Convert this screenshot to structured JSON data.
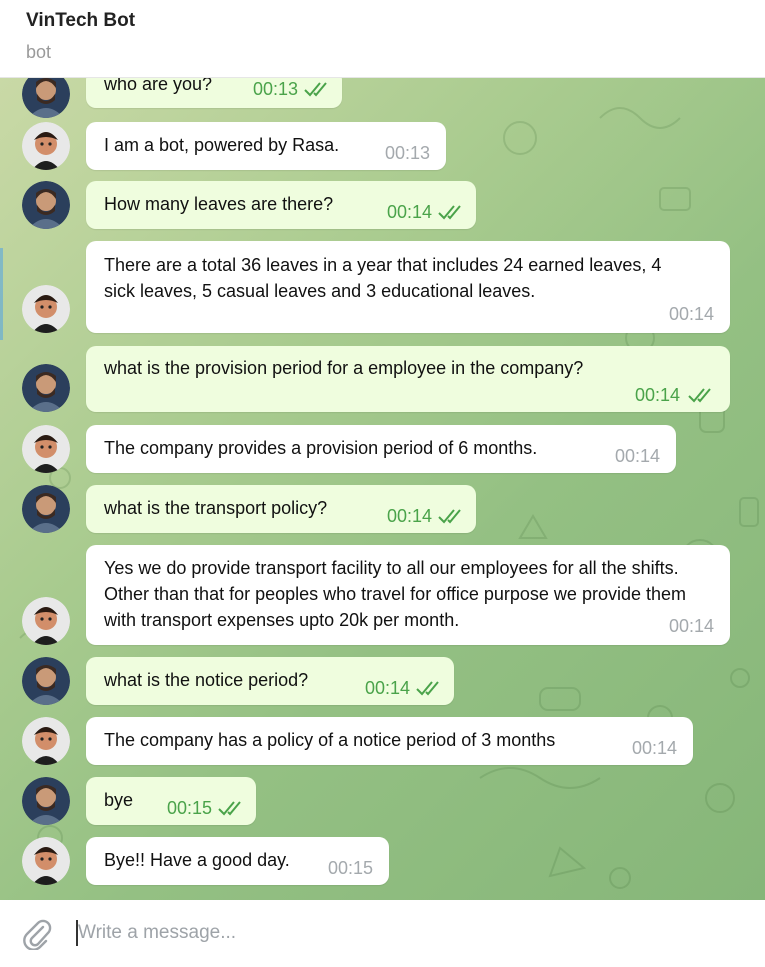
{
  "header": {
    "title": "VinTech Bot",
    "subtitle": "bot"
  },
  "messages": [
    {
      "from": "user",
      "text": "who are you?",
      "time": "00:13",
      "status": "read"
    },
    {
      "from": "bot",
      "text": "I am a bot, powered by Rasa.",
      "time": "00:13"
    },
    {
      "from": "user",
      "text": "How many leaves are there?",
      "time": "00:14",
      "status": "read"
    },
    {
      "from": "bot",
      "text": "There are a total 36 leaves in a year that includes 24 earned leaves, 4 sick leaves, 5 casual leaves and 3 educational leaves.",
      "time": "00:14"
    },
    {
      "from": "user",
      "text": "what is the provision period for a employee in the company?",
      "time": "00:14",
      "status": "read"
    },
    {
      "from": "bot",
      "text": "The company provides a provision period of 6 months.",
      "time": "00:14"
    },
    {
      "from": "user",
      "text": "what is the transport policy?",
      "time": "00:14",
      "status": "read"
    },
    {
      "from": "bot",
      "text": "Yes we do provide transport facility to all our employees for all the shifts. Other than that for peoples who travel for office purpose we provide them with transport expenses upto 20k per month.",
      "time": "00:14"
    },
    {
      "from": "user",
      "text": "what is the notice period?",
      "time": "00:14",
      "status": "read"
    },
    {
      "from": "bot",
      "text": "The company has a policy of a notice period of 3 months",
      "time": "00:14"
    },
    {
      "from": "user",
      "text": "bye",
      "time": "00:15",
      "status": "read"
    },
    {
      "from": "bot",
      "text": "Bye!! Have a good day.",
      "time": "00:15"
    }
  ],
  "composer": {
    "placeholder": "Write a message...",
    "attach_icon": "paperclip-icon"
  },
  "colors": {
    "outgoing_bubble": "#effdde",
    "incoming_bubble": "#ffffff",
    "read_check": "#4aa34a",
    "chat_background": "#94c083"
  }
}
